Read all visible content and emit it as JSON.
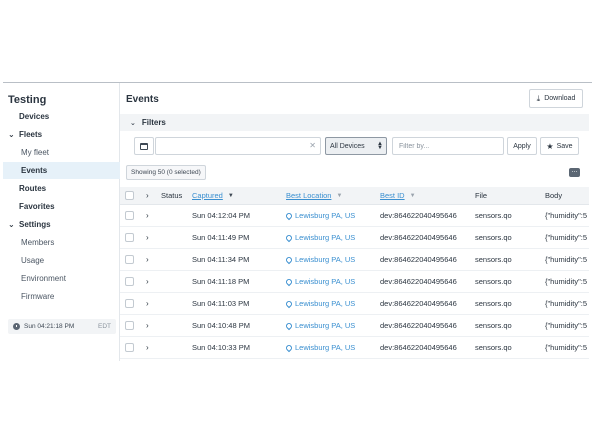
{
  "sidebar": {
    "project_title": "Testing",
    "items": [
      {
        "label": "Devices",
        "type": "top"
      },
      {
        "label": "Fleets",
        "type": "group"
      },
      {
        "label": "My fleet",
        "type": "sub"
      },
      {
        "label": "Events",
        "type": "sub",
        "active": true
      },
      {
        "label": "Routes",
        "type": "top"
      },
      {
        "label": "Favorites",
        "type": "top"
      },
      {
        "label": "Settings",
        "type": "group"
      },
      {
        "label": "Members",
        "type": "sub"
      },
      {
        "label": "Usage",
        "type": "sub"
      },
      {
        "label": "Environment",
        "type": "sub"
      },
      {
        "label": "Firmware",
        "type": "sub"
      }
    ],
    "clock": {
      "time": "Sun 04:21:18 PM",
      "tz": "EDT"
    }
  },
  "header": {
    "title": "Events",
    "download_label": "Download"
  },
  "filters": {
    "label": "Filters",
    "clear_glyph": "✕",
    "device_select_value": "All Devices",
    "filter_placeholder": "Filter by...",
    "apply_label": "Apply",
    "save_label": "Save"
  },
  "showing": "Showing 50 (0 selected)",
  "more_glyph": "...",
  "table": {
    "columns": {
      "status": "Status",
      "captured": "Captured",
      "best_location": "Best Location",
      "best_id": "Best ID",
      "file": "File",
      "body": "Body"
    },
    "rows": [
      {
        "captured": "Sun 04:12:04 PM",
        "location": "Lewisburg PA, US",
        "best_id": "dev:864622040495646",
        "file": "sensors.qo",
        "body": "{\"humidity\":5"
      },
      {
        "captured": "Sun 04:11:49 PM",
        "location": "Lewisburg PA, US",
        "best_id": "dev:864622040495646",
        "file": "sensors.qo",
        "body": "{\"humidity\":5"
      },
      {
        "captured": "Sun 04:11:34 PM",
        "location": "Lewisburg PA, US",
        "best_id": "dev:864622040495646",
        "file": "sensors.qo",
        "body": "{\"humidity\":5"
      },
      {
        "captured": "Sun 04:11:18 PM",
        "location": "Lewisburg PA, US",
        "best_id": "dev:864622040495646",
        "file": "sensors.qo",
        "body": "{\"humidity\":5"
      },
      {
        "captured": "Sun 04:11:03 PM",
        "location": "Lewisburg PA, US",
        "best_id": "dev:864622040495646",
        "file": "sensors.qo",
        "body": "{\"humidity\":5"
      },
      {
        "captured": "Sun 04:10:48 PM",
        "location": "Lewisburg PA, US",
        "best_id": "dev:864622040495646",
        "file": "sensors.qo",
        "body": "{\"humidity\":5"
      },
      {
        "captured": "Sun 04:10:33 PM",
        "location": "Lewisburg PA, US",
        "best_id": "dev:864622040495646",
        "file": "sensors.qo",
        "body": "{\"humidity\":5"
      }
    ]
  },
  "colors": {
    "accent": "#3a8fd0",
    "active_bg": "#e6f1f9",
    "panel_bg": "#f2f4f6"
  }
}
